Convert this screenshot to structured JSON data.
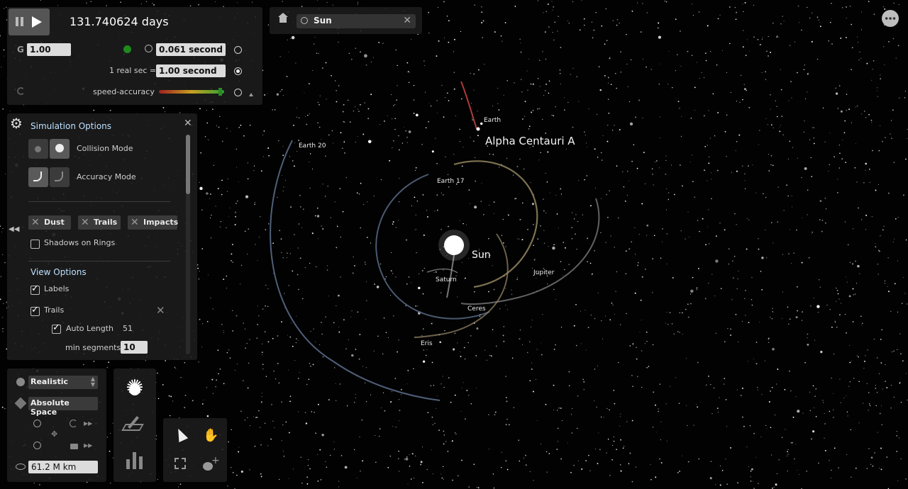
{
  "time": {
    "elapsed": "131.740624 days"
  },
  "controls": {
    "g_label": "G",
    "g_value": "1.00",
    "step_value": "0.061 seconds",
    "real_sec_label": "1 real sec =",
    "real_sec_value": "1.00 second",
    "speed_accuracy_label": "speed-accuracy"
  },
  "search": {
    "value": "Sun"
  },
  "sim_options": {
    "title": "Simulation Options",
    "collision_mode": "Collision Mode",
    "accuracy_mode": "Accuracy Mode",
    "dust": "Dust",
    "trails": "Trails",
    "impacts": "Impacts",
    "shadows_on_rings": "Shadows on Rings",
    "shadows_checked": false,
    "view_options_title": "View Options",
    "labels": "Labels",
    "labels_checked": true,
    "trails_view": "Trails",
    "trails_checked": true,
    "auto_length": "Auto Length",
    "auto_length_value": "51",
    "auto_length_checked": true,
    "min_segments": "min segments",
    "min_segments_value": "10"
  },
  "view_panel": {
    "render_mode": "Realistic",
    "space_mode": "Absolute Space",
    "distance": "61.2 M km"
  },
  "bodies": {
    "sun": "Sun",
    "alpha_centauri": "Alpha Centauri A",
    "earth": "Earth",
    "earth20": "Earth 20",
    "earth17": "Earth 17",
    "jupiter": "Jupiter",
    "saturn": "Saturn",
    "ceres": "Ceres",
    "eris": "Eris"
  },
  "colors": {
    "panel": "#1c1c1c",
    "accent_green": "#1e8a1e",
    "view_options_title": "#bde0ff"
  }
}
